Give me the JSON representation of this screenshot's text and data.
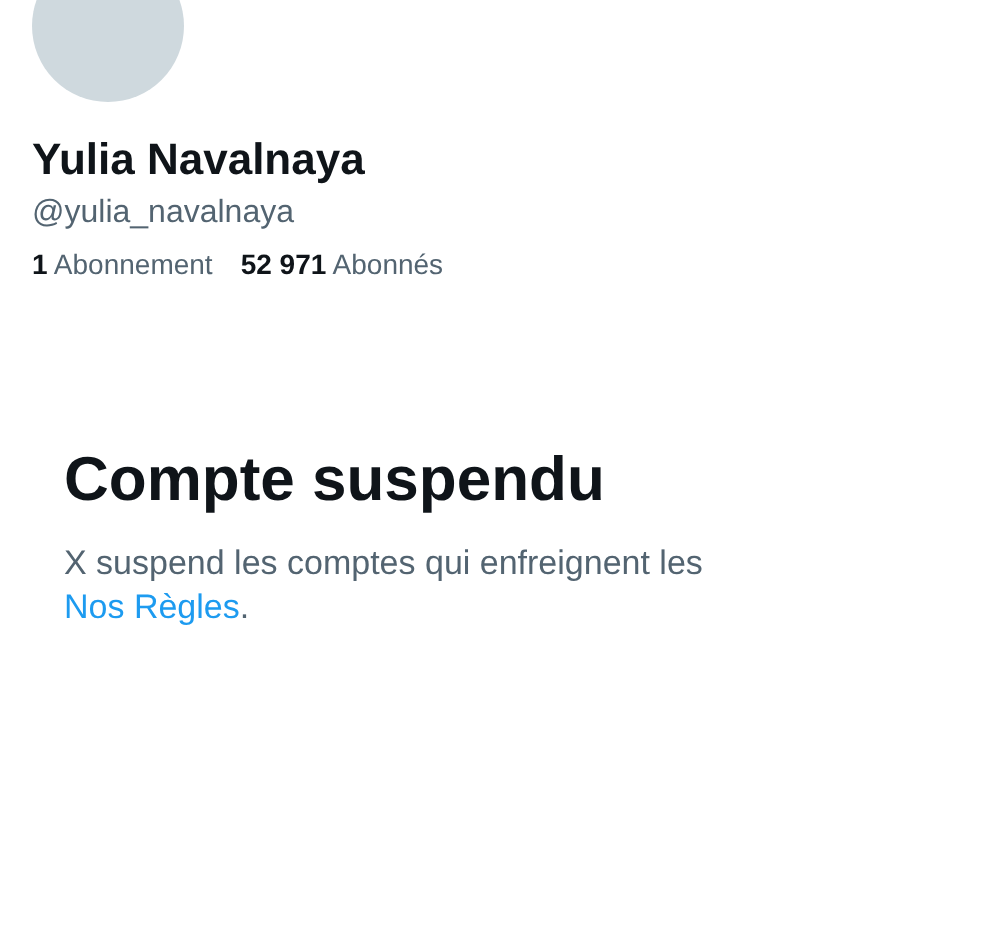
{
  "profile": {
    "name": "Yulia Navalnaya",
    "handle": "@yulia_navalnaya",
    "stats": [
      {
        "count": "1",
        "label": "Abonnement"
      },
      {
        "count": "52 971",
        "label": "Abonnés"
      }
    ]
  },
  "notice": {
    "title": "Compte suspendu",
    "text": "X suspend les comptes qui enfreignent les",
    "link": "Nos Règles",
    "end": "."
  }
}
